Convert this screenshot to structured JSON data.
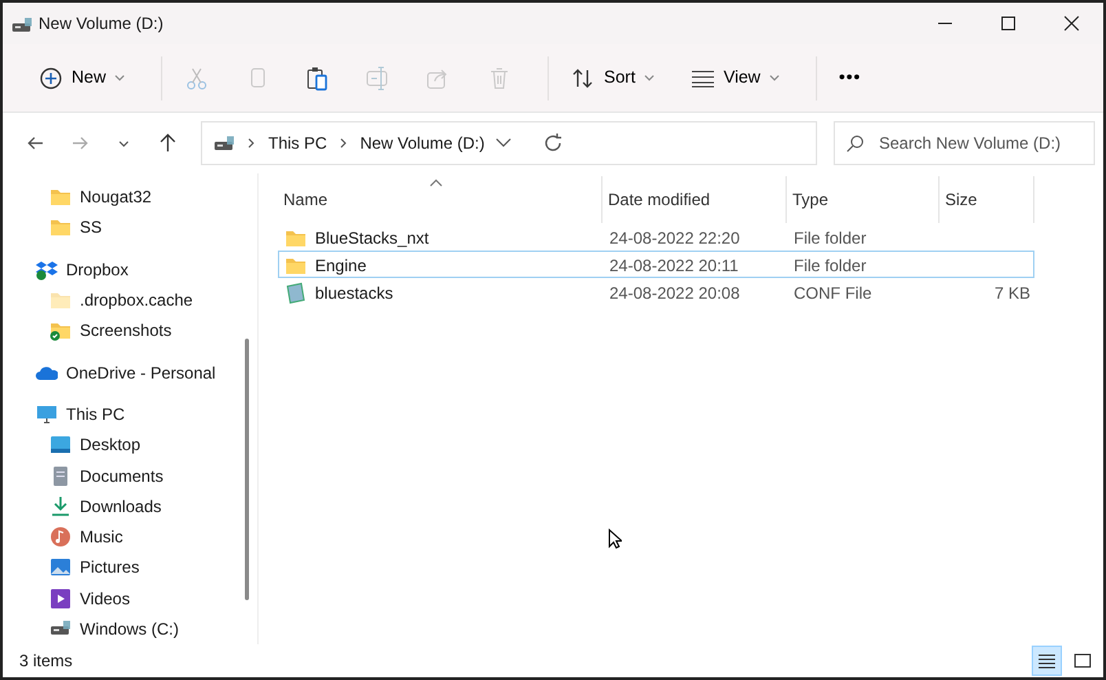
{
  "window": {
    "title": "New Volume (D:)"
  },
  "toolbar": [
    {
      "kind": "new",
      "label": "New",
      "disabled": false
    },
    {
      "kind": "cut",
      "disabled": true
    },
    {
      "kind": "copy",
      "disabled": true
    },
    {
      "kind": "paste",
      "disabled": false
    },
    {
      "kind": "rename",
      "disabled": true
    },
    {
      "kind": "share",
      "disabled": true
    },
    {
      "kind": "delete",
      "disabled": true
    },
    {
      "kind": "sort",
      "label": "Sort",
      "disabled": false
    },
    {
      "kind": "view",
      "label": "View",
      "disabled": false
    },
    {
      "kind": "more",
      "label": "•••",
      "disabled": false
    }
  ],
  "address": {
    "path": [
      "This PC",
      "New Volume (D:)"
    ]
  },
  "search": {
    "placeholder": "Search New Volume (D:)"
  },
  "sidebar": {
    "continued_children": [
      {
        "label": "Nougat32",
        "kind": "folder"
      },
      {
        "label": "SS",
        "kind": "folder"
      }
    ],
    "items": [
      {
        "label": "Dropbox",
        "kind": "dropbox",
        "children": [
          {
            "label": ".dropbox.cache",
            "kind": "folder-faded"
          },
          {
            "label": "Screenshots",
            "kind": "folder-synced"
          }
        ]
      },
      {
        "label": "OneDrive - Personal",
        "kind": "onedrive"
      },
      {
        "label": "This PC",
        "kind": "pc",
        "children": [
          {
            "label": "Desktop",
            "kind": "desktop"
          },
          {
            "label": "Documents",
            "kind": "documents"
          },
          {
            "label": "Downloads",
            "kind": "downloads"
          },
          {
            "label": "Music",
            "kind": "music"
          },
          {
            "label": "Pictures",
            "kind": "pictures"
          },
          {
            "label": "Videos",
            "kind": "videos"
          },
          {
            "label": "Windows (C:)",
            "kind": "drive"
          }
        ]
      }
    ]
  },
  "table": {
    "columns": [
      "Name",
      "Date modified",
      "Type",
      "Size"
    ],
    "rows": [
      {
        "kind": "folder",
        "name": "BlueStacks_nxt",
        "date": "24-08-2022 22:20",
        "type": "File folder",
        "focused": false
      },
      {
        "kind": "folder",
        "name": "Engine",
        "date": "24-08-2022 20:11",
        "type": "File folder",
        "focused": true
      },
      {
        "kind": "conf",
        "name": "bluestacks",
        "date": "24-08-2022 20:08",
        "type": "CONF File",
        "size": "7 KB",
        "focused": false
      }
    ]
  },
  "status_bar": {
    "text": "3 items",
    "views": [
      {
        "kind": "details",
        "selected": true
      },
      {
        "kind": "tiles",
        "selected": false
      }
    ]
  }
}
